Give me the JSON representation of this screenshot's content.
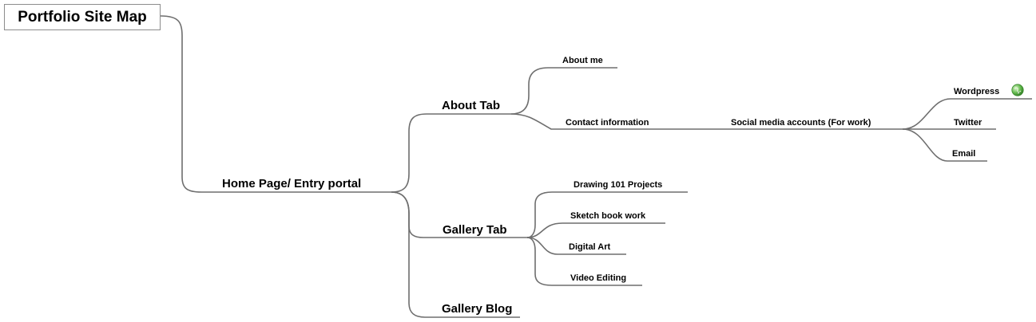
{
  "map": {
    "title": "Portfolio Site Map",
    "home": "Home Page/ Entry portal",
    "about_tab": "About Tab",
    "about_me": "About me",
    "contact": "Contact information",
    "social": "Social media accounts (For work)",
    "wordpress": "Wordpress",
    "twitter": "Twitter",
    "email": "Email",
    "gallery_tab": "Gallery Tab",
    "drawing": "Drawing 101 Projects",
    "sketch": "Sketch book work",
    "digital": "Digital Art",
    "video": "Video Editing",
    "gallery_blog": "Gallery Blog"
  },
  "colors": {
    "line": "#6e6e6e",
    "border": "#8c8c8c",
    "globe": "#5fb84a"
  },
  "icons": {
    "wordpress_link": "globe-link-icon"
  }
}
